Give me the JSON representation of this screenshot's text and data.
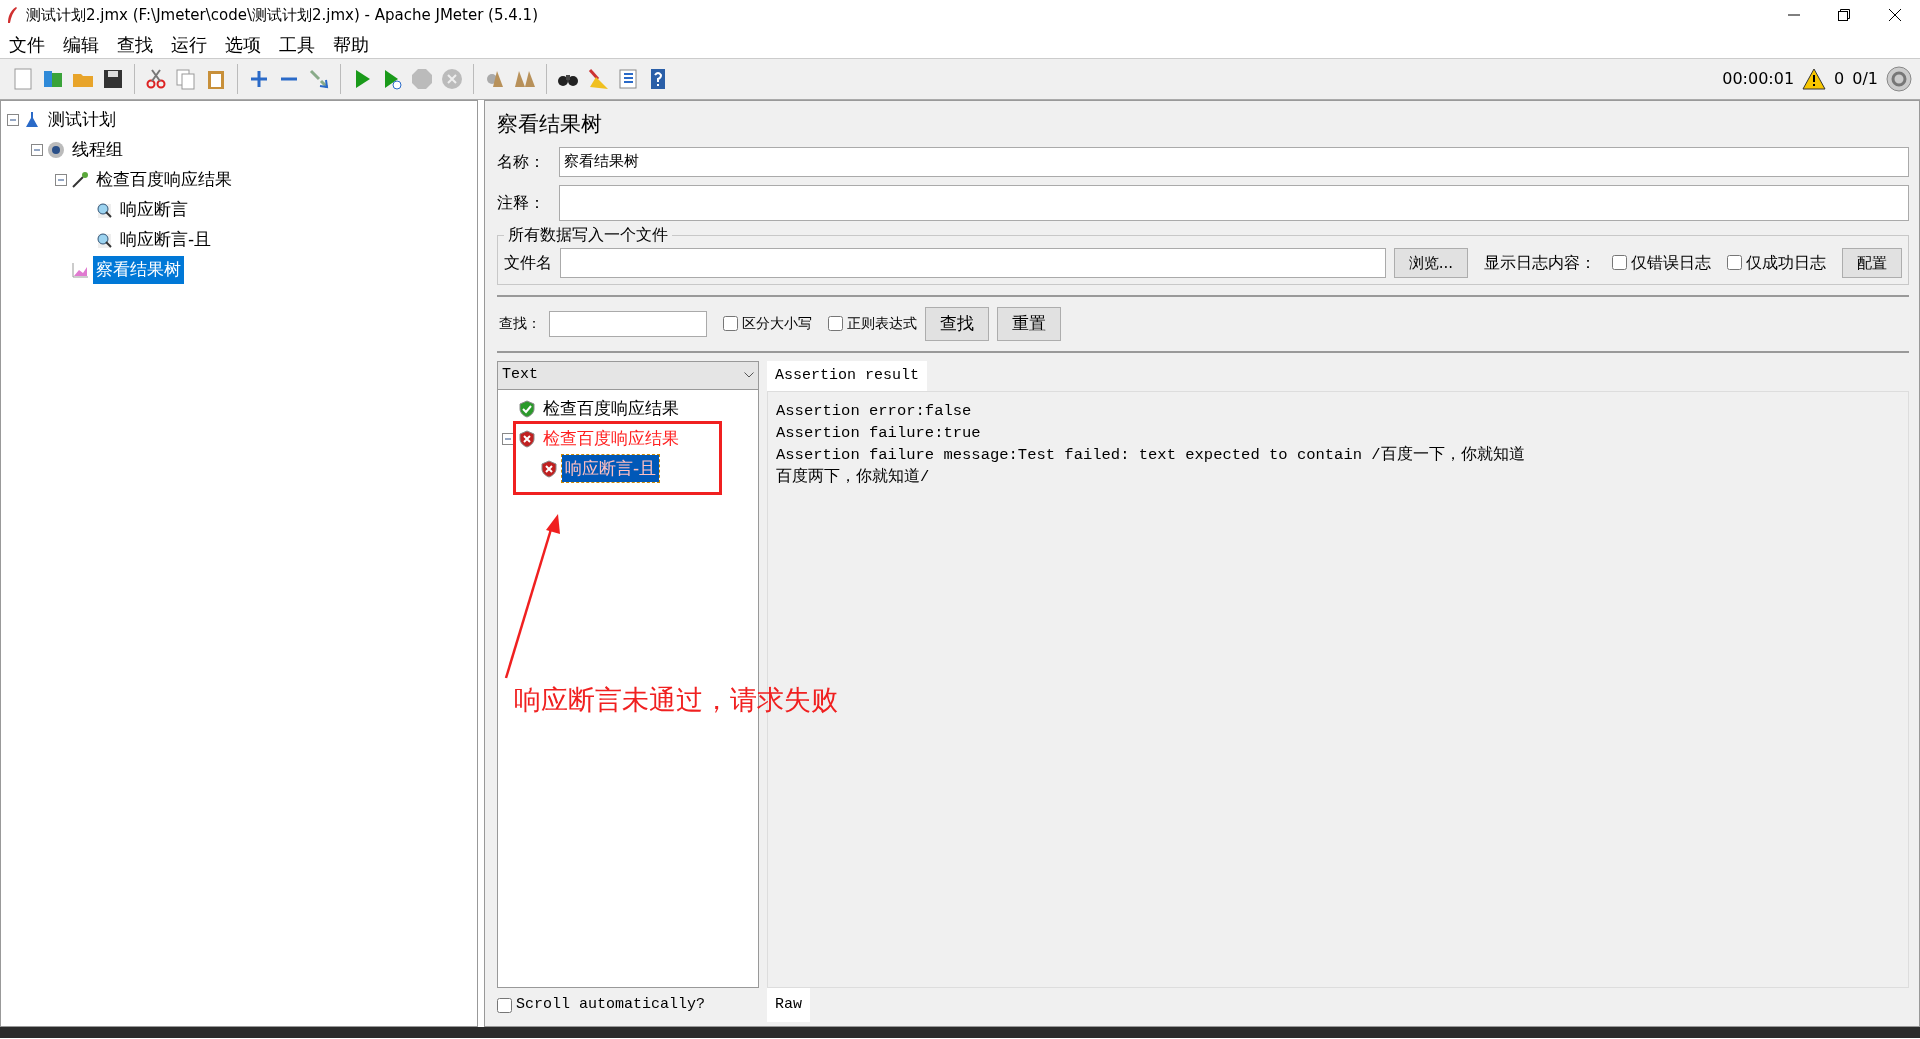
{
  "window": {
    "title": "测试计划2.jmx (F:\\Jmeter\\code\\测试计划2.jmx) - Apache JMeter (5.4.1)"
  },
  "menu": [
    "文件",
    "编辑",
    "查找",
    "运行",
    "选项",
    "工具",
    "帮助"
  ],
  "status": {
    "elapsed": "00:00:01",
    "warnings": "0",
    "threads": "0/1"
  },
  "tree": [
    {
      "label": "测试计划",
      "kind": "plan",
      "expanded": true,
      "selected": false,
      "children": [
        {
          "label": "线程组",
          "kind": "threads",
          "expanded": true,
          "selected": false,
          "children": [
            {
              "label": "检查百度响应结果",
              "kind": "sampler",
              "expanded": true,
              "selected": false,
              "children": [
                {
                  "label": "响应断言",
                  "kind": "assertion",
                  "selected": false
                },
                {
                  "label": "响应断言-且",
                  "kind": "assertion",
                  "selected": false
                }
              ]
            },
            {
              "label": "察看结果树",
              "kind": "listener",
              "selected": true
            }
          ]
        }
      ]
    }
  ],
  "panel": {
    "title": "察看结果树",
    "name_label": "名称：",
    "name_value": "察看结果树",
    "comment_label": "注释：",
    "file_group": "所有数据写入一个文件",
    "file_label": "文件名",
    "browse": "浏览...",
    "log_label": "显示日志内容：",
    "errors_only": {
      "label": "仅错误日志",
      "checked": false
    },
    "success_only": {
      "label": "仅成功日志",
      "checked": false
    },
    "configure": "配置"
  },
  "search": {
    "label": "查找：",
    "case": {
      "label": "区分大小写",
      "checked": false
    },
    "regex": {
      "label": "正则表达式",
      "checked": false
    },
    "find": "查找",
    "reset": "重置"
  },
  "renderer": "Text",
  "results": [
    {
      "label": "检查百度响应结果",
      "kind": "pass",
      "selected": false
    },
    {
      "label": "检查百度响应结果",
      "kind": "fail",
      "expanded": true,
      "selected": false,
      "children": [
        {
          "label": "响应断言-且",
          "kind": "fail",
          "selected": true
        }
      ]
    }
  ],
  "scroll_auto": {
    "label": "Scroll automatically?",
    "checked": false
  },
  "tabs": [
    {
      "label": "Assertion result",
      "selected": true
    }
  ],
  "result_lines": [
    "Assertion error:false",
    "Assertion failure:true",
    "Assertion failure message:Test failed: text expected to contain /百度一下，你就知道",
    "百度两下，你就知道/"
  ],
  "bottom_tabs": [
    {
      "label": "Raw",
      "selected": true
    }
  ],
  "annotation": {
    "text": "响应断言未通过，请求失败"
  }
}
